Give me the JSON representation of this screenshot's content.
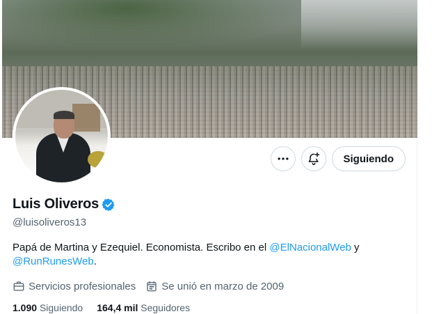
{
  "profile": {
    "display_name": "Luis Oliveros",
    "handle": "@luisoliveros13",
    "verified": true,
    "bio": {
      "text_1": "Papá de Martina y Ezequiel. Economista. Escribo en el ",
      "link_1": "@ElNacionalWeb",
      "text_2": " y ",
      "link_2": "@RunRunesWeb",
      "text_3": "."
    },
    "meta": {
      "category": "Servicios profesionales",
      "joined": "Se unió en marzo de 2009"
    },
    "stats": {
      "following_count": "1.090",
      "following_label": "Siguiendo",
      "followers_count": "164,4 mil",
      "followers_label": "Seguidores"
    }
  },
  "actions": {
    "more_icon": "more-horizontal-icon",
    "notify_icon": "bell-plus-icon",
    "follow_label": "Siguiendo"
  },
  "colors": {
    "accent": "#1d9bf0",
    "text_primary": "#0f1419",
    "text_secondary": "#536471",
    "border": "#cfd9de"
  }
}
